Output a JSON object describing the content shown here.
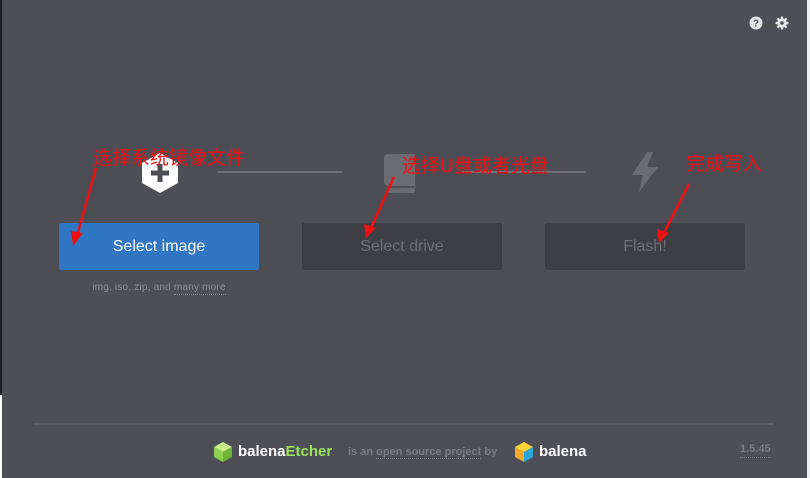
{
  "header": {
    "help_icon": "help-circle-icon",
    "settings_icon": "gear-icon"
  },
  "steps": {
    "image": {
      "icon": "image-plus-hexagon-icon",
      "button_label": "Select image",
      "formats": "img, iso, zip, and",
      "formats_more": "many more"
    },
    "drive": {
      "icon": "drive-icon",
      "button_label": "Select drive"
    },
    "flash": {
      "icon": "lightning-bolt-icon",
      "button_label": "Flash!"
    }
  },
  "annotations": {
    "image": "选择系统镜像文件",
    "drive": "选择U盘或者光盘",
    "flash": "完成写入"
  },
  "footer": {
    "etcher_brand_prefix": "balena",
    "etcher_brand_accent": "Etcher",
    "oss_text_pre": "is an",
    "oss_text_link": "open source project",
    "oss_text_post": "by",
    "balena_brand": "balena",
    "version": "1.5.45"
  },
  "colors": {
    "background": "#4e4f56",
    "primary": "#3176c2",
    "disabled": "#3e3f44",
    "accent_green": "#9ae35a",
    "annotation_red": "#ee1111"
  }
}
